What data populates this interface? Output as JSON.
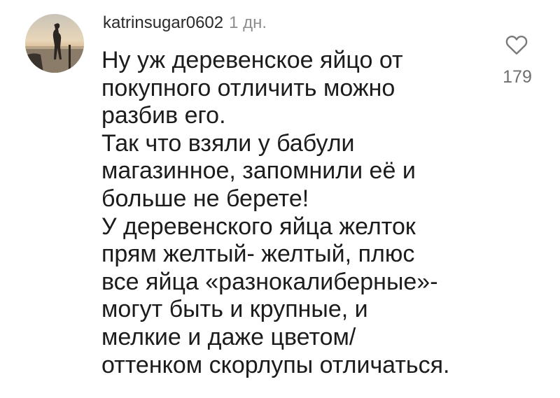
{
  "comment": {
    "username": "katrinsugar0602",
    "timestamp": "1 дн.",
    "lines": [
      "Ну уж деревенское яйцо от",
      "покупного отличить можно",
      "разбив его.",
      "Так что взяли у бабули",
      "магазинное, запомнили её и",
      "больше не берете!",
      "У деревенского яйца желток",
      "прям желтый- желтый, плюс",
      "все яйца «разнокалиберные»-",
      "могут быть и крупные, и",
      "мелкие и даже цветом/",
      "оттенком скорлупы отличаться."
    ],
    "like_count": "179",
    "like_icon": "heart-outline-icon"
  }
}
